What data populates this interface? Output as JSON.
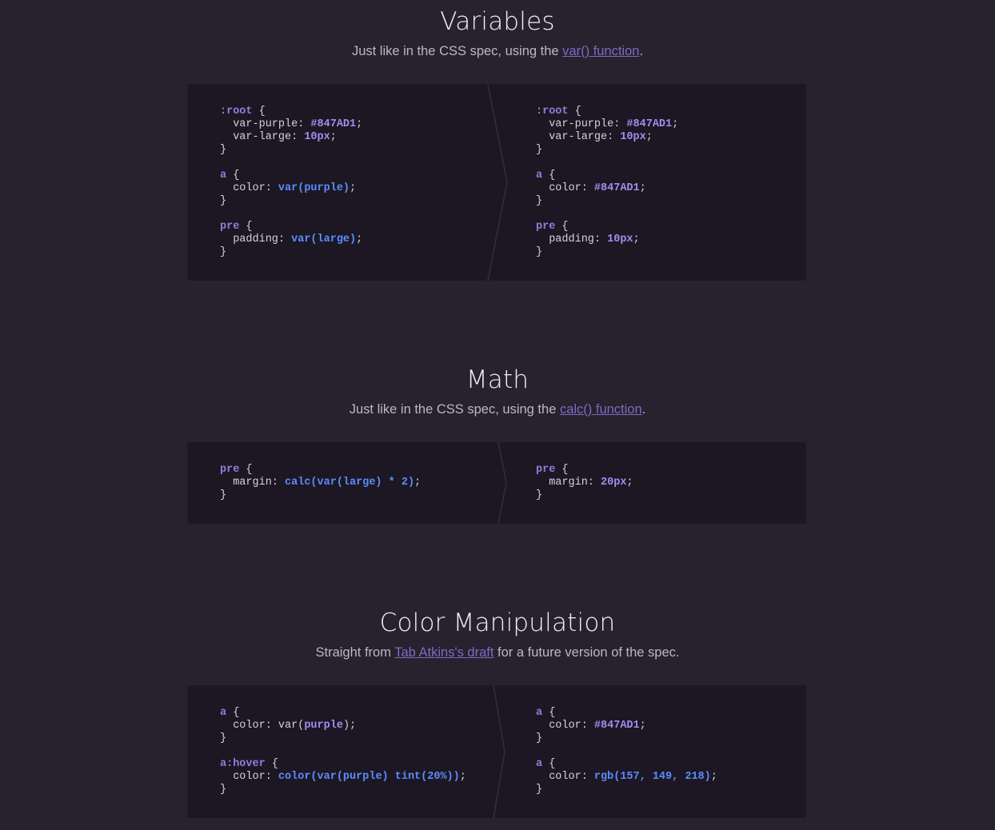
{
  "sections": {
    "variables": {
      "title": "Variables",
      "sub_before": "Just like in the CSS spec, using the ",
      "sub_link": "var() function",
      "sub_after": "."
    },
    "math": {
      "title": "Math",
      "sub_before": "Just like in the CSS spec, using the ",
      "sub_link": "calc() function",
      "sub_after": "."
    },
    "color": {
      "title": "Color Manipulation",
      "sub_before": "Straight from ",
      "sub_link": "Tab Atkins's draft",
      "sub_after": " for a future version of the spec."
    }
  },
  "code": {
    "variables": {
      "left": [
        [
          {
            "t": ":root",
            "c": "sel"
          },
          {
            "t": " {",
            "c": "br"
          }
        ],
        [
          {
            "t": "  var-purple: ",
            "c": ""
          },
          {
            "t": "#847AD1",
            "c": "val"
          },
          {
            "t": ";",
            "c": ""
          }
        ],
        [
          {
            "t": "  var-large: ",
            "c": ""
          },
          {
            "t": "10px",
            "c": "val"
          },
          {
            "t": ";",
            "c": ""
          }
        ],
        [
          {
            "t": "}",
            "c": "br"
          }
        ],
        [],
        [
          {
            "t": "a",
            "c": "sel"
          },
          {
            "t": " {",
            "c": "br"
          }
        ],
        [
          {
            "t": "  color: ",
            "c": ""
          },
          {
            "t": "var(purple)",
            "c": "fn"
          },
          {
            "t": ";",
            "c": ""
          }
        ],
        [
          {
            "t": "}",
            "c": "br"
          }
        ],
        [],
        [
          {
            "t": "pre",
            "c": "sel"
          },
          {
            "t": " {",
            "c": "br"
          }
        ],
        [
          {
            "t": "  padding: ",
            "c": ""
          },
          {
            "t": "var(large)",
            "c": "fn"
          },
          {
            "t": ";",
            "c": ""
          }
        ],
        [
          {
            "t": "}",
            "c": "br"
          }
        ]
      ],
      "right": [
        [
          {
            "t": ":root",
            "c": "sel"
          },
          {
            "t": " {",
            "c": "br"
          }
        ],
        [
          {
            "t": "  var-purple: ",
            "c": ""
          },
          {
            "t": "#847AD1",
            "c": "val"
          },
          {
            "t": ";",
            "c": ""
          }
        ],
        [
          {
            "t": "  var-large: ",
            "c": ""
          },
          {
            "t": "10px",
            "c": "val"
          },
          {
            "t": ";",
            "c": ""
          }
        ],
        [
          {
            "t": "}",
            "c": "br"
          }
        ],
        [],
        [
          {
            "t": "a",
            "c": "sel"
          },
          {
            "t": " {",
            "c": "br"
          }
        ],
        [
          {
            "t": "  color: ",
            "c": ""
          },
          {
            "t": "#847AD1",
            "c": "val"
          },
          {
            "t": ";",
            "c": ""
          }
        ],
        [
          {
            "t": "}",
            "c": "br"
          }
        ],
        [],
        [
          {
            "t": "pre",
            "c": "sel"
          },
          {
            "t": " {",
            "c": "br"
          }
        ],
        [
          {
            "t": "  padding: ",
            "c": ""
          },
          {
            "t": "10px",
            "c": "val"
          },
          {
            "t": ";",
            "c": ""
          }
        ],
        [
          {
            "t": "}",
            "c": "br"
          }
        ]
      ]
    },
    "math": {
      "left": [
        [
          {
            "t": "pre",
            "c": "sel"
          },
          {
            "t": " {",
            "c": "br"
          }
        ],
        [
          {
            "t": "  margin: ",
            "c": ""
          },
          {
            "t": "calc(var(large) * 2)",
            "c": "fn"
          },
          {
            "t": ";",
            "c": ""
          }
        ],
        [
          {
            "t": "}",
            "c": "br"
          }
        ]
      ],
      "right": [
        [
          {
            "t": "pre",
            "c": "sel"
          },
          {
            "t": " {",
            "c": "br"
          }
        ],
        [
          {
            "t": "  margin: ",
            "c": ""
          },
          {
            "t": "20px",
            "c": "val"
          },
          {
            "t": ";",
            "c": ""
          }
        ],
        [
          {
            "t": "}",
            "c": "br"
          }
        ]
      ]
    },
    "color": {
      "left": [
        [
          {
            "t": "a",
            "c": "sel"
          },
          {
            "t": " {",
            "c": "br"
          }
        ],
        [
          {
            "t": "  color: var(",
            "c": ""
          },
          {
            "t": "purple",
            "c": "val"
          },
          {
            "t": ");",
            "c": ""
          }
        ],
        [
          {
            "t": "}",
            "c": "br"
          }
        ],
        [],
        [
          {
            "t": "a:hover",
            "c": "sel"
          },
          {
            "t": " {",
            "c": "br"
          }
        ],
        [
          {
            "t": "  color: ",
            "c": ""
          },
          {
            "t": "color(var(purple) tint(20%))",
            "c": "fn"
          },
          {
            "t": ";",
            "c": ""
          }
        ],
        [
          {
            "t": "}",
            "c": "br"
          }
        ]
      ],
      "right": [
        [
          {
            "t": "a",
            "c": "sel"
          },
          {
            "t": " {",
            "c": "br"
          }
        ],
        [
          {
            "t": "  color: ",
            "c": ""
          },
          {
            "t": "#847AD1",
            "c": "val"
          },
          {
            "t": ";",
            "c": ""
          }
        ],
        [
          {
            "t": "}",
            "c": "br"
          }
        ],
        [],
        [
          {
            "t": "a",
            "c": "sel"
          },
          {
            "t": " {",
            "c": "br"
          }
        ],
        [
          {
            "t": "  color: ",
            "c": ""
          },
          {
            "t": "rgb(157, 149, 218)",
            "c": "fn"
          },
          {
            "t": ";",
            "c": ""
          }
        ],
        [
          {
            "t": "}",
            "c": "br"
          }
        ]
      ]
    }
  },
  "colors": {
    "background": "#27222d",
    "panel": "#1c1722",
    "selector": "#8e7fe0",
    "function": "#5c8cff",
    "value": "#9f8ff0",
    "link": "#7a6cc4"
  }
}
